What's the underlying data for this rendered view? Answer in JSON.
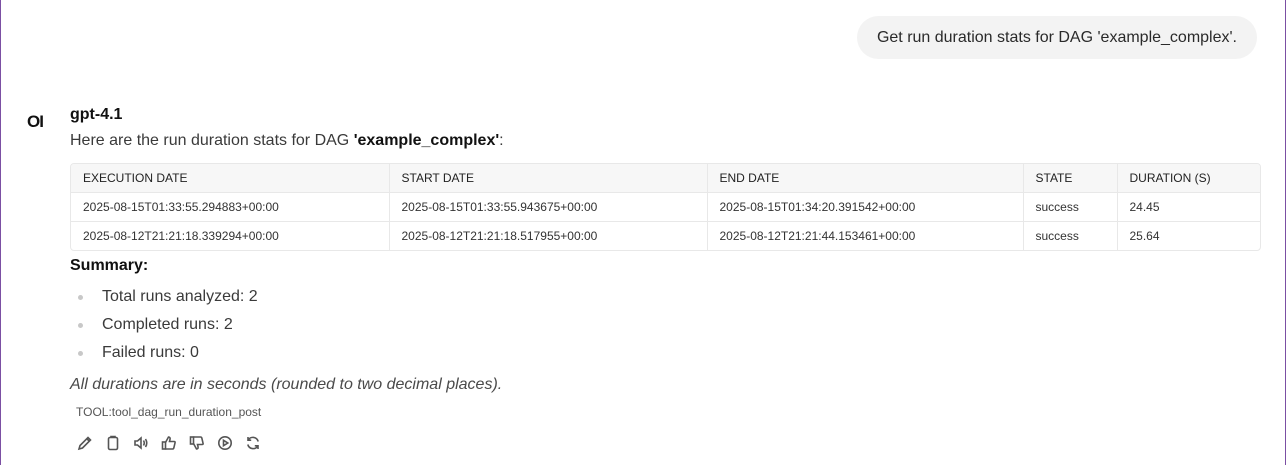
{
  "user_message": "Get run duration stats for DAG 'example_complex'.",
  "assistant": {
    "avatar_text": "OI",
    "model_name": "gpt-4.1",
    "intro_prefix": "Here are the run duration stats for DAG ",
    "intro_dag": "'example_complex'",
    "intro_suffix": ":"
  },
  "table": {
    "headers": [
      "Execution Date",
      "Start Date",
      "End Date",
      "State",
      "Duration (s)"
    ],
    "rows": [
      [
        "2025-08-15T01:33:55.294883+00:00",
        "2025-08-15T01:33:55.943675+00:00",
        "2025-08-15T01:34:20.391542+00:00",
        "success",
        "24.45"
      ],
      [
        "2025-08-12T21:21:18.339294+00:00",
        "2025-08-12T21:21:18.517955+00:00",
        "2025-08-12T21:21:44.153461+00:00",
        "success",
        "25.64"
      ]
    ]
  },
  "summary": {
    "title": "Summary:",
    "items": [
      "Total runs analyzed: 2",
      "Completed runs: 2",
      "Failed runs: 0"
    ]
  },
  "note": "All durations are in seconds (rounded to two decimal places).",
  "tool_tag": "TOOL:tool_dag_run_duration_post",
  "actions": [
    "edit-icon",
    "copy-icon",
    "read-aloud-icon",
    "thumbs-up-icon",
    "thumbs-down-icon",
    "continue-icon",
    "regenerate-icon"
  ]
}
